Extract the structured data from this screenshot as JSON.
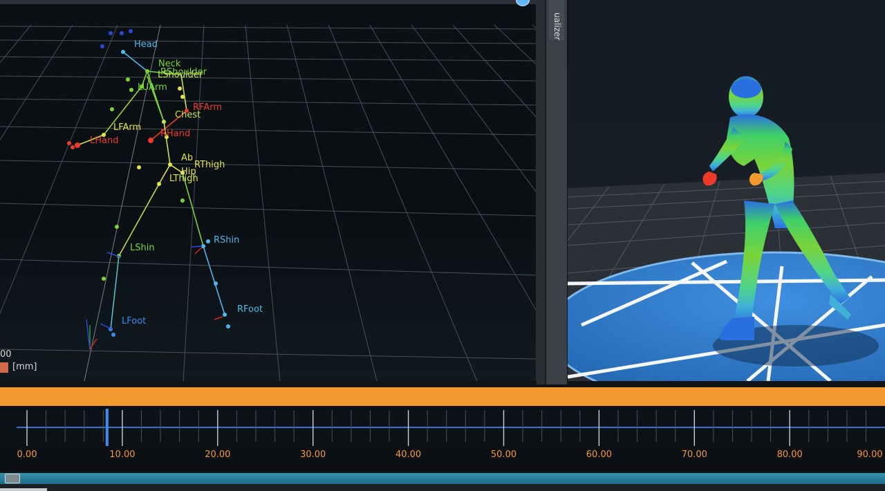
{
  "colors": {
    "accent_orange": "#f39a2f",
    "timeline_blue": "#2f73d8",
    "grid": "#6e7780",
    "joint_blue": "#4fb8e8",
    "joint_green": "#7ad43a",
    "joint_yellow": "#e3e34a",
    "joint_red": "#ee3a2a",
    "figure_green": "#5fd43c",
    "floor_blue": "#2f7fd0"
  },
  "skeleton_view": {
    "joint_labels": [
      {
        "text": "Head",
        "color": "#4fb8e8"
      },
      {
        "text": "Neck",
        "color": "#7ad43a"
      },
      {
        "text": "RShoulder",
        "color": "#7ad43a"
      },
      {
        "text": "LShoulder",
        "color": "#c9e24a"
      },
      {
        "text": "LUArm",
        "color": "#7ad43a"
      },
      {
        "text": "RFArm",
        "color": "#ee3a2a"
      },
      {
        "text": "Chest",
        "color": "#c9e24a"
      },
      {
        "text": "LFArm",
        "color": "#e3e34a"
      },
      {
        "text": "RHand",
        "color": "#ee3a2a"
      },
      {
        "text": "LHand",
        "color": "#ee3a2a"
      },
      {
        "text": "Ab",
        "color": "#e3e34a"
      },
      {
        "text": "RThigh",
        "color": "#e3e34a"
      },
      {
        "text": "Hip",
        "color": "#e3e34a"
      },
      {
        "text": "LThigh",
        "color": "#e3e34a"
      },
      {
        "text": "RShin",
        "color": "#4fb8e8"
      },
      {
        "text": "LShin",
        "color": "#7ad43a"
      },
      {
        "text": "RFoot",
        "color": "#4fb8e8"
      },
      {
        "text": "LFoot",
        "color": "#3a8ce8"
      }
    ],
    "scale_value": "00",
    "scale_unit": "[mm]"
  },
  "visualizer_tab": {
    "label": "ualizer"
  },
  "timeline": {
    "tick_labels": [
      "0.00",
      "10.00",
      "20.00",
      "30.00",
      "40.00",
      "50.00",
      "60.00",
      "70.00",
      "80.00",
      "90.00"
    ],
    "playhead_value": 8.4
  }
}
